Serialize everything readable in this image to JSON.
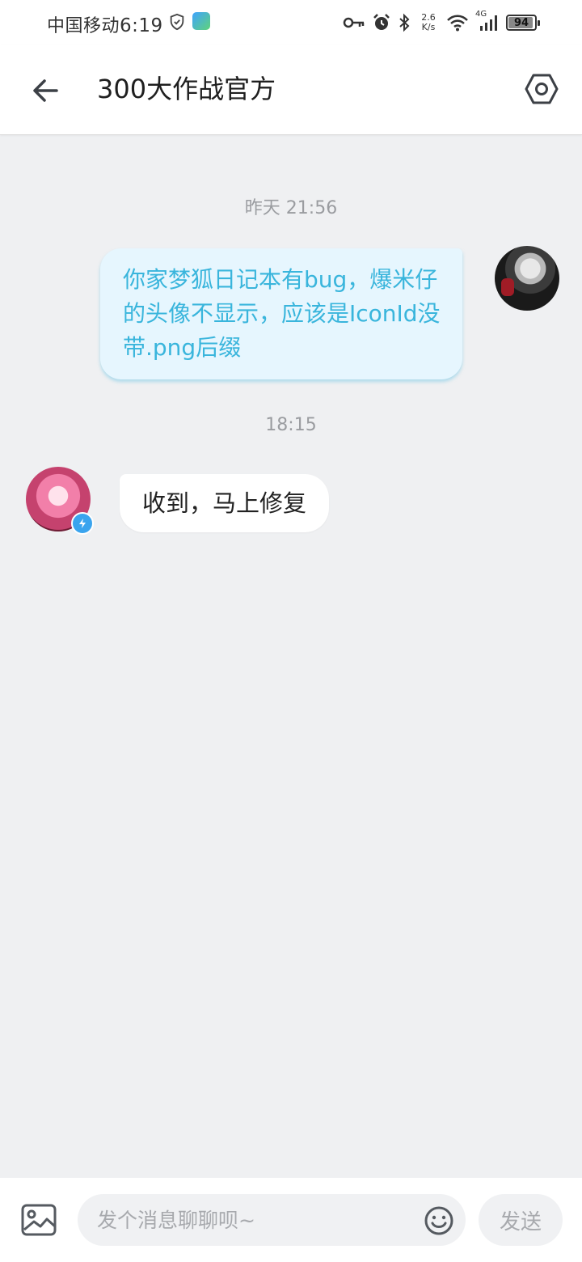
{
  "status_bar": {
    "carrier": "中国移动",
    "time": "6:19",
    "network_speed_value": "2.6",
    "network_speed_unit": "K/s",
    "network_type": "4G",
    "battery": "94",
    "battery_level": 0.94
  },
  "header": {
    "title": "300大作战官方",
    "back_icon": "arrow-left-icon",
    "settings_icon": "hexagon-settings-icon"
  },
  "messages": [
    {
      "timestamp": "昨天 21:56",
      "direction": "outgoing",
      "text": "你家梦狐日记本有bug，爆米仔的头像不显示，应该是IconId没带.png后缀"
    },
    {
      "timestamp": "18:15",
      "direction": "incoming",
      "text": "收到，马上修复",
      "verified": true
    }
  ],
  "input_bar": {
    "placeholder": "发个消息聊聊呗~",
    "value": "",
    "send_label": "发送",
    "image_icon": "image-icon",
    "emoji_icon": "emoji-icon"
  },
  "colors": {
    "background": "#eff0f2",
    "outgoing_bubble": "#e6f6fe",
    "outgoing_text": "#39b5dc",
    "incoming_bubble": "#ffffff",
    "verified_badge": "#3aa4ee"
  }
}
